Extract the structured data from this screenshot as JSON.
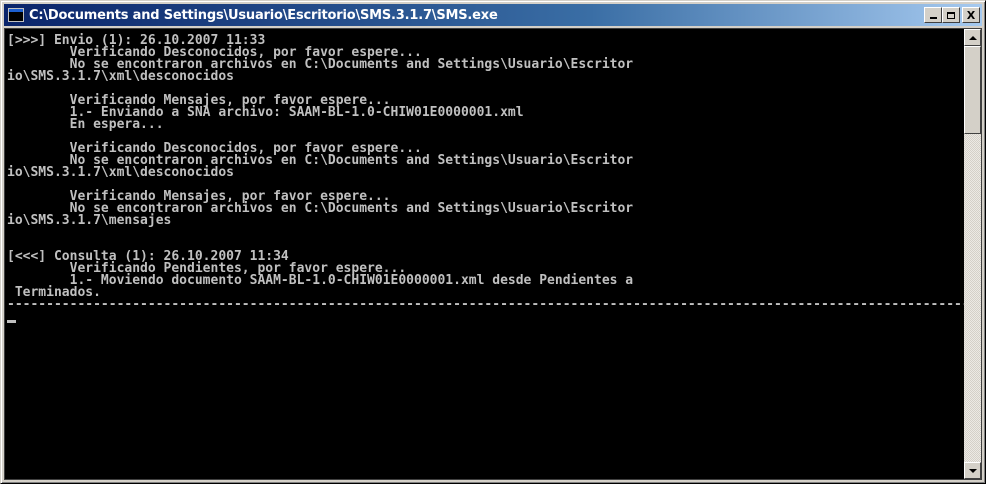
{
  "window": {
    "title": "C:\\Documents and Settings\\Usuario\\Escritorio\\SMS.3.1.7\\SMS.exe",
    "icon": "console-icon",
    "controls": {
      "minimize": "_",
      "maximize": "□",
      "close": "X"
    }
  },
  "console": {
    "scroll_position": 0.0,
    "lines": [
      "[>>>] Envio (1): 26.10.2007 11:33",
      "        Verificando Desconocidos, por favor espere...",
      "        No se encontraron archivos en C:\\Documents and Settings\\Usuario\\Escritor",
      "io\\SMS.3.1.7\\xml\\desconocidos",
      "",
      "        Verificando Mensajes, por favor espere...",
      "        1.- Enviando a SNA archivo: SAAM-BL-1.0-CHIW01E0000001.xml",
      "        En espera...",
      "",
      "        Verificando Desconocidos, por favor espere...",
      "        No se encontraron archivos en C:\\Documents and Settings\\Usuario\\Escritor",
      "io\\SMS.3.1.7\\xml\\desconocidos",
      "",
      "        Verificando Mensajes, por favor espere...",
      "        No se encontraron archivos en C:\\Documents and Settings\\Usuario\\Escritor",
      "io\\SMS.3.1.7\\mensajes",
      "",
      "",
      "[<<<] Consulta (1): 26.10.2007 11:34",
      "        Verificando Pendientes, por favor espere...",
      "        1.- Moviendo documento SAAM-BL-1.0-CHIW01E0000001.xml desde Pendientes a",
      " Terminados.",
      "------------------------------------------------------------------------------------------------------------------------------------------------------"
    ]
  },
  "colors": {
    "console_bg": "#000000",
    "console_fg": "#c0c0c0",
    "titlebar_start": "#0a246a",
    "titlebar_end": "#a6caf0",
    "chrome": "#d4d0c8"
  }
}
